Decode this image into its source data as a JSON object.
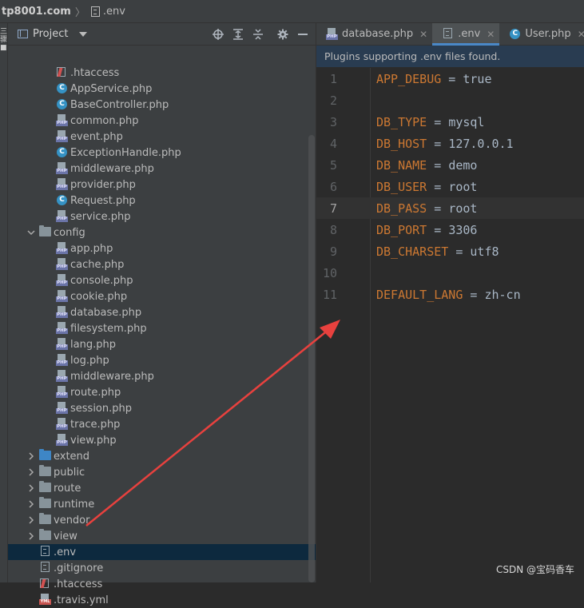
{
  "breadcrumb": {
    "host": "tp8001.com",
    "file": ".env"
  },
  "left_strip": {
    "marks": "三\n骤\n■"
  },
  "project_panel": {
    "title": "Project",
    "tools": [
      "crosshair-icon",
      "expand-all-icon",
      "collapse-all-icon",
      "gear-icon",
      "minimize-icon"
    ]
  },
  "tree": [
    {
      "label": ".htaccess",
      "icon": "htaccess",
      "indent": 2
    },
    {
      "label": "AppService.php",
      "icon": "class",
      "indent": 2
    },
    {
      "label": "BaseController.php",
      "icon": "class",
      "indent": 2
    },
    {
      "label": "common.php",
      "icon": "php",
      "indent": 2
    },
    {
      "label": "event.php",
      "icon": "php",
      "indent": 2
    },
    {
      "label": "ExceptionHandle.php",
      "icon": "class",
      "indent": 2
    },
    {
      "label": "middleware.php",
      "icon": "php",
      "indent": 2
    },
    {
      "label": "provider.php",
      "icon": "php",
      "indent": 2
    },
    {
      "label": "Request.php",
      "icon": "class",
      "indent": 2
    },
    {
      "label": "service.php",
      "icon": "php",
      "indent": 2
    },
    {
      "label": "config",
      "icon": "folder",
      "indent": 1,
      "arrow": "down"
    },
    {
      "label": "app.php",
      "icon": "php",
      "indent": 2
    },
    {
      "label": "cache.php",
      "icon": "php",
      "indent": 2
    },
    {
      "label": "console.php",
      "icon": "php",
      "indent": 2
    },
    {
      "label": "cookie.php",
      "icon": "php",
      "indent": 2
    },
    {
      "label": "database.php",
      "icon": "php",
      "indent": 2
    },
    {
      "label": "filesystem.php",
      "icon": "php",
      "indent": 2
    },
    {
      "label": "lang.php",
      "icon": "php",
      "indent": 2
    },
    {
      "label": "log.php",
      "icon": "php",
      "indent": 2
    },
    {
      "label": "middleware.php",
      "icon": "php",
      "indent": 2
    },
    {
      "label": "route.php",
      "icon": "php",
      "indent": 2
    },
    {
      "label": "session.php",
      "icon": "php",
      "indent": 2
    },
    {
      "label": "trace.php",
      "icon": "php",
      "indent": 2
    },
    {
      "label": "view.php",
      "icon": "php",
      "indent": 2
    },
    {
      "label": "extend",
      "icon": "folder-blue",
      "indent": 1,
      "arrow": "right"
    },
    {
      "label": "public",
      "icon": "folder",
      "indent": 1,
      "arrow": "right"
    },
    {
      "label": "route",
      "icon": "folder",
      "indent": 1,
      "arrow": "right"
    },
    {
      "label": "runtime",
      "icon": "folder",
      "indent": 1,
      "arrow": "right"
    },
    {
      "label": "vendor",
      "icon": "folder",
      "indent": 1,
      "arrow": "right"
    },
    {
      "label": "view",
      "icon": "folder",
      "indent": 1,
      "arrow": "right"
    },
    {
      "label": ".env",
      "icon": "doc",
      "indent": 1,
      "selected": true
    },
    {
      "label": ".gitignore",
      "icon": "doc",
      "indent": 1
    },
    {
      "label": ".htaccess",
      "icon": "htaccess",
      "indent": 1
    },
    {
      "label": ".travis.yml",
      "icon": "yml",
      "indent": 1
    }
  ],
  "tabs": [
    {
      "label": "database.php",
      "icon": "php",
      "active": false
    },
    {
      "label": ".env",
      "icon": "doc",
      "active": true
    },
    {
      "label": "User.php",
      "icon": "class",
      "active": false
    }
  ],
  "banner": "Plugins supporting .env files found.",
  "code": [
    {
      "n": "1",
      "key": "APP_DEBUG",
      "value": "true"
    },
    {
      "n": "2",
      "key": "",
      "value": ""
    },
    {
      "n": "3",
      "key": "DB_TYPE",
      "value": "mysql"
    },
    {
      "n": "4",
      "key": "DB_HOST",
      "value": "127.0.0.1"
    },
    {
      "n": "5",
      "key": "DB_NAME",
      "value": "demo"
    },
    {
      "n": "6",
      "key": "DB_USER",
      "value": "root"
    },
    {
      "n": "7",
      "key": "DB_PASS",
      "value": "root",
      "current": true
    },
    {
      "n": "8",
      "key": "DB_PORT",
      "value": "3306"
    },
    {
      "n": "9",
      "key": "DB_CHARSET",
      "value": "utf8"
    },
    {
      "n": "10",
      "key": "",
      "value": ""
    },
    {
      "n": "11",
      "key": "DEFAULT_LANG",
      "value": "zh-cn"
    }
  ],
  "watermark": "CSDN @宝码香车",
  "colors": {
    "annotation_arrow": "#e8413e",
    "key": "#cc7832",
    "selection": "#0d293e"
  }
}
